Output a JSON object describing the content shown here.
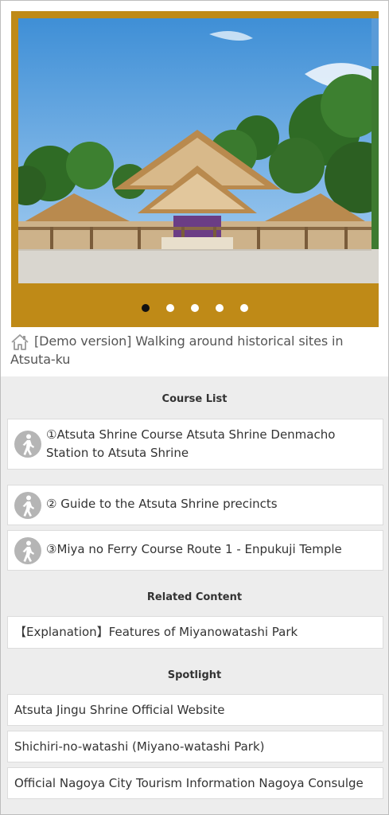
{
  "slider": {
    "dots": [
      true,
      false,
      false,
      false,
      false
    ],
    "colors": {
      "frame": "#bf8a17"
    }
  },
  "header": {
    "title": "[Demo version] Walking around historical sites in Atsuta-ku"
  },
  "course_list": {
    "heading": "Course List",
    "items": [
      {
        "label": "①Atsuta Shrine Course Atsuta Shrine Denmacho Station to Atsuta Shrine"
      },
      {
        "label": "② Guide to the Atsuta Shrine precincts"
      },
      {
        "label": "③Miya no Ferry Course Route 1 - Enpukuji Temple"
      }
    ]
  },
  "related": {
    "heading": "Related Content",
    "items": [
      {
        "label": "【Explanation】Features of Miyanowatashi Park"
      }
    ]
  },
  "spotlight": {
    "heading": "Spotlight",
    "items": [
      {
        "label": "Atsuta Jingu Shrine Official Website"
      },
      {
        "label": "Shichiri-no-watashi (Miyano-watashi Park)"
      },
      {
        "label": "Official Nagoya City Tourism Information Nagoya Consulge"
      }
    ]
  }
}
